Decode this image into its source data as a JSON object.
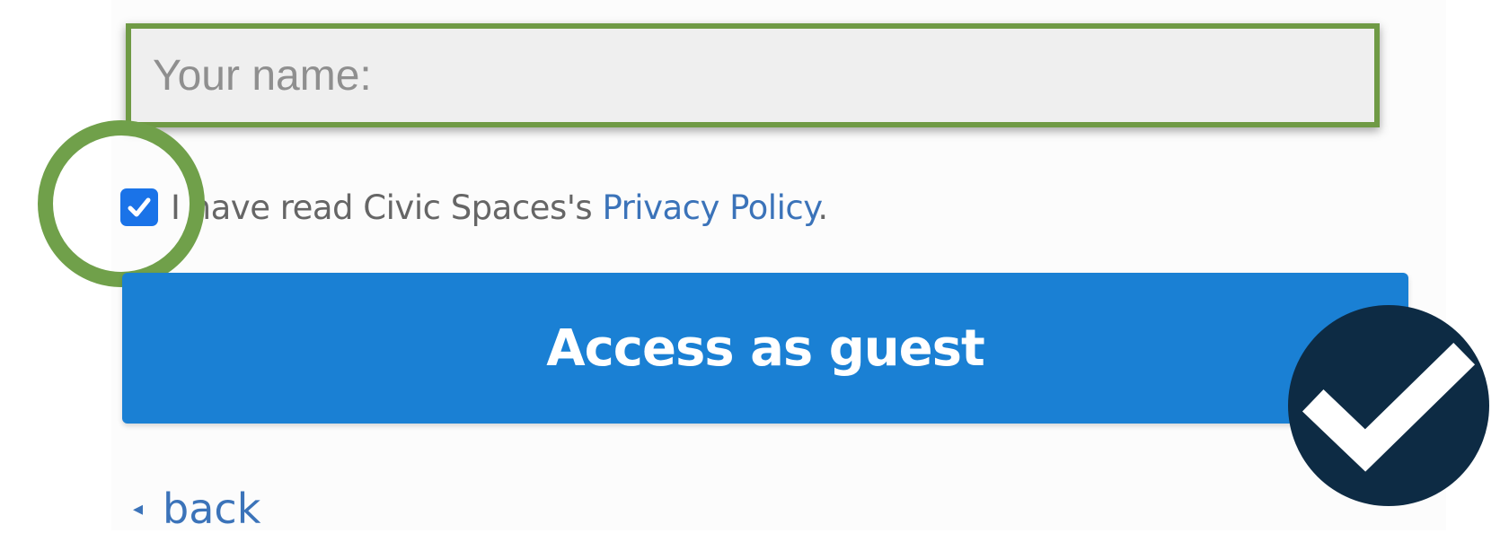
{
  "form": {
    "name_placeholder": "Your name:",
    "name_value": "",
    "consent": {
      "checked": true,
      "text_before": "I have read Civic Spaces's ",
      "link_text": "Privacy Policy",
      "text_after": "."
    },
    "submit_label": "Access as guest",
    "back": {
      "arrow": "◂",
      "label": "back"
    }
  },
  "annotations": {
    "input_highlight_color": "#6f9a45",
    "checkbox_highlight_color": "#70a04a",
    "success_badge_color": "#0d2b44",
    "success_badge_icon": "check-icon"
  },
  "colors": {
    "button": "#1a80d4",
    "link": "#3b73b9",
    "checkbox": "#1a73e8"
  }
}
